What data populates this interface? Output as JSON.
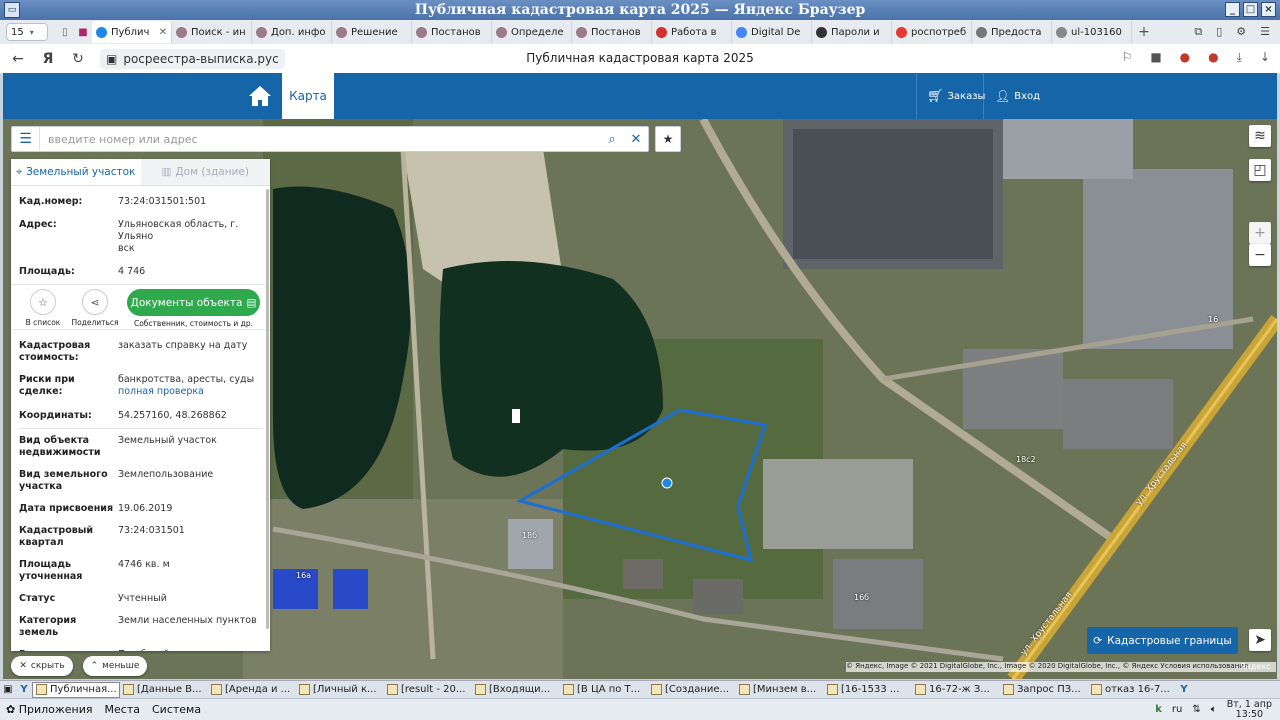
{
  "window": {
    "title": "Публичная кадастровая карта 2025 — Яндекс Браузер"
  },
  "browser": {
    "tab_count": "15",
    "tabs": [
      {
        "label": "Публич",
        "color": "#1e88e5",
        "active": true
      },
      {
        "label": "Поиск - ин",
        "color": "#9b7a8a"
      },
      {
        "label": "Доп. инфо",
        "color": "#9b7a8a"
      },
      {
        "label": "Решение",
        "color": "#9b7a8a"
      },
      {
        "label": "Постанов",
        "color": "#9b7a8a"
      },
      {
        "label": "Определе",
        "color": "#9b7a8a"
      },
      {
        "label": "Постанов",
        "color": "#9b7a8a"
      },
      {
        "label": "Работа в",
        "color": "#d32f2f"
      },
      {
        "label": "Digital De",
        "color": "#4285f4"
      },
      {
        "label": "Пароли и",
        "color": "#333333"
      },
      {
        "label": "роспотреб",
        "color": "#e53935"
      },
      {
        "label": "Предоста",
        "color": "#777777"
      },
      {
        "label": "ul-103160",
        "color": "#888888"
      }
    ],
    "url": "росреестра-выписка.рус",
    "page_title": "Публичная кадастровая карта 2025"
  },
  "header": {
    "nav_map": "Карта",
    "orders": "Заказы",
    "login": "Вход"
  },
  "search": {
    "placeholder": "введите номер или адрес"
  },
  "panel": {
    "tab_land": "Земельный участок",
    "tab_house": "Дом (здание)",
    "cad_number_label": "Кад.номер:",
    "cad_number": "73:24:031501:501",
    "address_label": "Адрес:",
    "address_line1": "Ульяновская область, г. Ульяно",
    "address_line2": "вск",
    "area_label": "Площадь:",
    "area": "4 746",
    "action_list": "В список",
    "action_share": "Поделиться",
    "docs_button": "Документы объекта",
    "docs_sub": "Собственник, стоимость и др.",
    "cad_cost_label1": "Кадастровая",
    "cad_cost_label2": "стоимость:",
    "cad_cost_link": "заказать справку на дату",
    "risks_label": "Риски при сделке:",
    "risks_text": "банкротства, аресты, суды",
    "risks_link": "полная проверка",
    "coords_label": "Координаты:",
    "coords": "54.257160, 48.268862",
    "details": [
      {
        "k1": "Вид объекта",
        "k2": "недвижимости",
        "v": "Земельный участок"
      },
      {
        "k1": "Вид земельного",
        "k2": "участка",
        "v": "Землепользование"
      },
      {
        "k1": "Дата присвоения",
        "k2": "",
        "v": "19.06.2019"
      },
      {
        "k1": "Кадастровый",
        "k2": "квартал",
        "v": "73:24:031501"
      },
      {
        "k1": "Площадь уточненная",
        "k2": "",
        "v": "4746 кв. м"
      },
      {
        "k1": "Статус",
        "k2": "",
        "v": "Учтенный"
      },
      {
        "k1": "Категория земель",
        "k2": "",
        "v": "Земли населенных пунктов"
      },
      {
        "k1": "Вид разрешенного",
        "k2": "использования",
        "v": "Под базой"
      }
    ]
  },
  "bottom_controls": {
    "hide": "скрыть",
    "less": "меньше"
  },
  "map": {
    "kad_button": "Кадастровые границы",
    "copyright": "© Яндекс, Image © 2021 DigitalGlobe, Inc., Image © 2020 DigitalGlobe, Inc., © Яндекс Условия использования",
    "yandex": "Яндекс",
    "labels": [
      "16",
      "18с2",
      "18б",
      "16б",
      "16а"
    ],
    "street": "ул. Хрустальная",
    "street2": "ул. Хрустальная"
  },
  "taskbar": {
    "items": [
      {
        "label": "Публичная...",
        "active": true
      },
      {
        "label": "[Данные В..."
      },
      {
        "label": "[Аренда и ..."
      },
      {
        "label": "[Личный к..."
      },
      {
        "label": "[result - 20..."
      },
      {
        "label": "[Входящи..."
      },
      {
        "label": "[В ЦА по Т..."
      },
      {
        "label": "[Создание..."
      },
      {
        "label": "[Минзем в..."
      },
      {
        "label": "[16-1533 ..."
      },
      {
        "label": "16-72-ж З..."
      },
      {
        "label": "Запрос ПЗ..."
      },
      {
        "label": "отказ 16-7..."
      }
    ]
  },
  "system_panel": {
    "apps": "Приложения",
    "places": "Места",
    "system": "Система",
    "lang": "ru",
    "day": "Вт,",
    "date": "1 апр",
    "time": "13:50"
  }
}
